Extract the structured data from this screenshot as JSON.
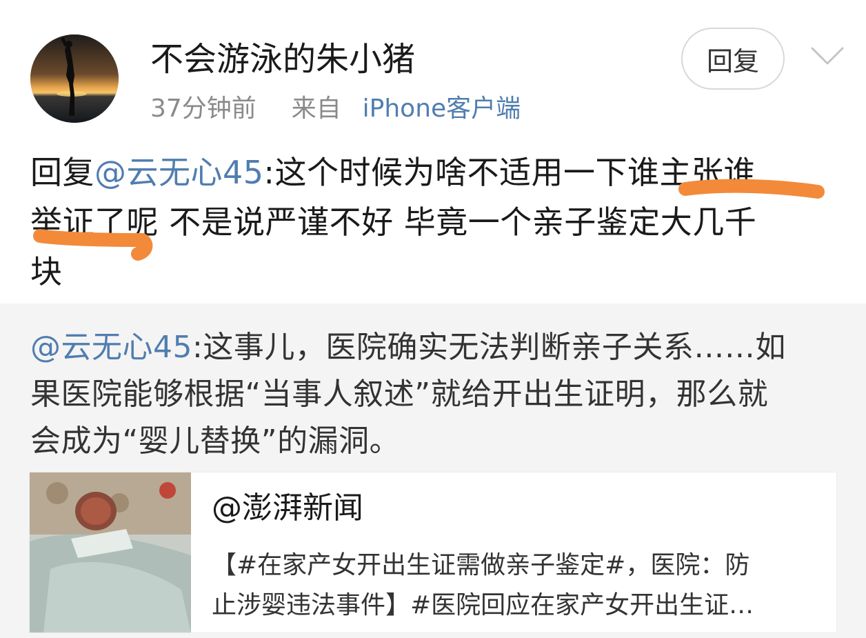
{
  "post": {
    "username": "不会游泳的朱小猪",
    "time": "37分钟前",
    "source_prefix": "来自",
    "source": "iPhone客户端",
    "reply_label": "回复"
  },
  "comment": {
    "reply_prefix": "回复",
    "mention": "@云无心45",
    "text_line1": ":这个时候为啥不适用一下谁主张谁",
    "text_line2": "举证了呢 不是说严谨不好 毕竟一个亲子鉴定大几千",
    "text_line3": "块"
  },
  "quote": {
    "mention": "@云无心45",
    "text_line1": ":这事儿，医院确实无法判断亲子关系……如",
    "text_line2": "果医院能够根据“当事人叙述”就给开出生证明，那么就",
    "text_line3": "会成为“婴儿替换”的漏洞。"
  },
  "card": {
    "title": "@澎湃新闻",
    "desc_line1": "【#在家产女开出生证需做亲子鉴定#，医院：防",
    "desc_line2": "止涉婴违法事件】#医院回应在家产女开出生证…"
  },
  "colors": {
    "link": "#507daf",
    "marker": "#f28a3a",
    "quote_bg": "#f4f4f4"
  },
  "icons": {
    "expand": "chevron-down-icon"
  }
}
